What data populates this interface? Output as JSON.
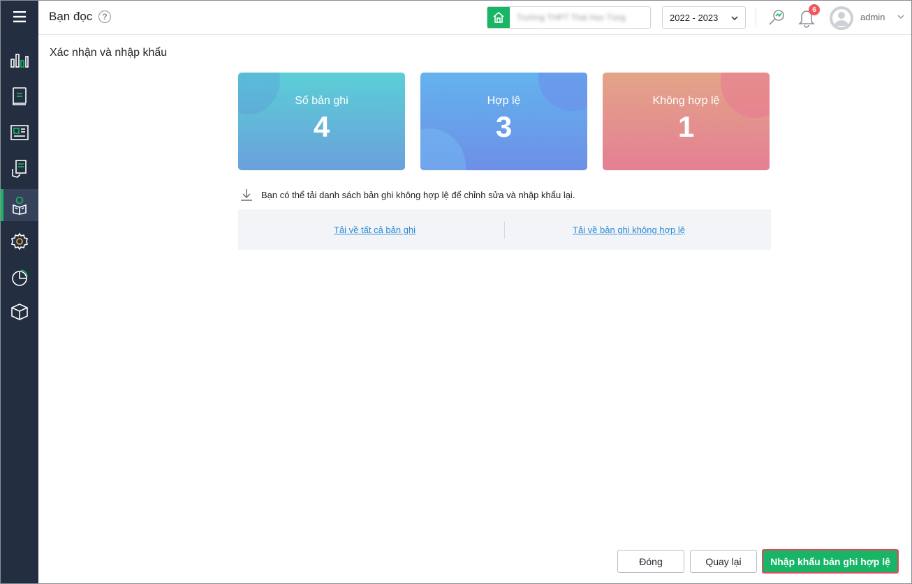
{
  "header": {
    "title": "Bạn đọc",
    "help_symbol": "?",
    "school_name": "Trường THPT Thái Học Tùng",
    "school_year": "2022 - 2023",
    "notification_count": "6",
    "user_name": "admin"
  },
  "sidebar": {
    "items": [
      {
        "icon": "chart-bars-icon"
      },
      {
        "icon": "book-icon"
      },
      {
        "icon": "newspaper-icon"
      },
      {
        "icon": "hand-document-icon"
      },
      {
        "icon": "reader-icon",
        "active": true
      },
      {
        "icon": "gear-icon"
      },
      {
        "icon": "pie-chart-icon"
      },
      {
        "icon": "box-icon"
      }
    ]
  },
  "main": {
    "section_title": "Xác nhận và nhập khẩu",
    "cards": [
      {
        "label": "Số bản ghi",
        "value": "4"
      },
      {
        "label": "Hợp lệ",
        "value": "3"
      },
      {
        "label": "Không hợp lệ",
        "value": "1"
      }
    ],
    "hint": "Bạn có thể tải danh sách bản ghi không hợp lệ để chỉnh sửa và nhập khẩu lại.",
    "download_all": "Tải về tất cả bản ghi",
    "download_invalid": "Tải về bản ghi không hợp lệ"
  },
  "footer": {
    "close_label": "Đóng",
    "back_label": "Quay lại",
    "import_label": "Nhập khẩu bản ghi hợp lệ"
  },
  "colors": {
    "sidebar_bg": "#232e41",
    "accent_green": "#18b566",
    "link_blue": "#2a8bd8",
    "badge_red": "#f0575e"
  }
}
